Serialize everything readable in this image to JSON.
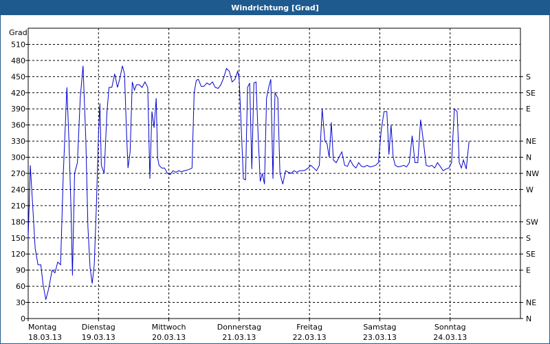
{
  "window": {
    "title": "Windrichtung [Grad]"
  },
  "chart_data": {
    "type": "line",
    "title": "Windrichtung [Grad]",
    "ylabel": "Grad",
    "ylim": [
      0,
      540
    ],
    "yticks": [
      0,
      30,
      60,
      90,
      120,
      150,
      180,
      210,
      240,
      270,
      300,
      330,
      360,
      390,
      420,
      450,
      480,
      510
    ],
    "right_labels": [
      {
        "value": 0,
        "label": "N"
      },
      {
        "value": 30,
        "label": "NE"
      },
      {
        "value": 90,
        "label": "E"
      },
      {
        "value": 120,
        "label": "SE"
      },
      {
        "value": 150,
        "label": "S"
      },
      {
        "value": 180,
        "label": "SW"
      },
      {
        "value": 240,
        "label": "W"
      },
      {
        "value": 270,
        "label": "NW"
      },
      {
        "value": 300,
        "label": "N"
      },
      {
        "value": 330,
        "label": "NE"
      },
      {
        "value": 390,
        "label": "E"
      },
      {
        "value": 420,
        "label": "SE"
      },
      {
        "value": 450,
        "label": "S"
      }
    ],
    "days": [
      {
        "day": "Montag",
        "date": "18.03.13"
      },
      {
        "day": "Dienstag",
        "date": "19.03.13"
      },
      {
        "day": "Mittwoch",
        "date": "20.03.13"
      },
      {
        "day": "Donnerstag",
        "date": "21.03.13"
      },
      {
        "day": "Freitag",
        "date": "22.03.13"
      },
      {
        "day": "Samstag",
        "date": "23.03.13"
      },
      {
        "day": "Sonntag",
        "date": "24.03.13"
      }
    ],
    "xlim_days": [
      0,
      7
    ],
    "grid": true,
    "line_color": "#0000cc",
    "series": [
      {
        "values": [
          [
            0.0,
            150
          ],
          [
            0.03,
            285
          ],
          [
            0.06,
            220
          ],
          [
            0.1,
            130
          ],
          [
            0.14,
            100
          ],
          [
            0.18,
            100
          ],
          [
            0.21,
            65
          ],
          [
            0.25,
            35
          ],
          [
            0.29,
            55
          ],
          [
            0.34,
            90
          ],
          [
            0.38,
            85
          ],
          [
            0.42,
            105
          ],
          [
            0.46,
            100
          ],
          [
            0.5,
            270
          ],
          [
            0.55,
            430
          ],
          [
            0.58,
            330
          ],
          [
            0.61,
            200
          ],
          [
            0.63,
            80
          ],
          [
            0.66,
            270
          ],
          [
            0.7,
            290
          ],
          [
            0.74,
            410
          ],
          [
            0.78,
            470
          ],
          [
            0.82,
            330
          ],
          [
            0.85,
            170
          ],
          [
            0.88,
            95
          ],
          [
            0.91,
            65
          ],
          [
            0.94,
            100
          ],
          [
            0.97,
            210
          ],
          [
            1.0,
            345
          ],
          [
            1.02,
            400
          ],
          [
            1.04,
            285
          ],
          [
            1.08,
            270
          ],
          [
            1.12,
            385
          ],
          [
            1.15,
            430
          ],
          [
            1.19,
            430
          ],
          [
            1.23,
            455
          ],
          [
            1.27,
            430
          ],
          [
            1.3,
            445
          ],
          [
            1.34,
            470
          ],
          [
            1.37,
            455
          ],
          [
            1.4,
            340
          ],
          [
            1.42,
            280
          ],
          [
            1.45,
            310
          ],
          [
            1.48,
            440
          ],
          [
            1.51,
            425
          ],
          [
            1.54,
            435
          ],
          [
            1.58,
            435
          ],
          [
            1.62,
            430
          ],
          [
            1.66,
            440
          ],
          [
            1.7,
            430
          ],
          [
            1.73,
            260
          ],
          [
            1.76,
            385
          ],
          [
            1.79,
            355
          ],
          [
            1.82,
            410
          ],
          [
            1.84,
            300
          ],
          [
            1.86,
            285
          ],
          [
            1.9,
            280
          ],
          [
            1.94,
            280
          ],
          [
            1.98,
            270
          ],
          [
            2.02,
            268
          ],
          [
            2.06,
            275
          ],
          [
            2.1,
            272
          ],
          [
            2.14,
            275
          ],
          [
            2.18,
            273
          ],
          [
            2.22,
            275
          ],
          [
            2.26,
            276
          ],
          [
            2.3,
            278
          ],
          [
            2.33,
            280
          ],
          [
            2.36,
            420
          ],
          [
            2.39,
            443
          ],
          [
            2.42,
            445
          ],
          [
            2.46,
            432
          ],
          [
            2.5,
            432
          ],
          [
            2.54,
            438
          ],
          [
            2.58,
            435
          ],
          [
            2.62,
            440
          ],
          [
            2.66,
            430
          ],
          [
            2.7,
            428
          ],
          [
            2.74,
            435
          ],
          [
            2.78,
            448
          ],
          [
            2.82,
            465
          ],
          [
            2.86,
            460
          ],
          [
            2.9,
            440
          ],
          [
            2.94,
            445
          ],
          [
            2.98,
            460
          ],
          [
            3.0,
            445
          ],
          [
            3.03,
            355
          ],
          [
            3.06,
            260
          ],
          [
            3.09,
            258
          ],
          [
            3.12,
            430
          ],
          [
            3.15,
            438
          ],
          [
            3.18,
            278
          ],
          [
            3.21,
            438
          ],
          [
            3.24,
            440
          ],
          [
            3.27,
            340
          ],
          [
            3.3,
            255
          ],
          [
            3.33,
            270
          ],
          [
            3.36,
            250
          ],
          [
            3.39,
            410
          ],
          [
            3.42,
            430
          ],
          [
            3.45,
            445
          ],
          [
            3.48,
            260
          ],
          [
            3.51,
            420
          ],
          [
            3.55,
            410
          ],
          [
            3.58,
            270
          ],
          [
            3.62,
            250
          ],
          [
            3.66,
            275
          ],
          [
            3.7,
            272
          ],
          [
            3.74,
            270
          ],
          [
            3.78,
            275
          ],
          [
            3.82,
            272
          ],
          [
            3.86,
            275
          ],
          [
            3.9,
            275
          ],
          [
            3.94,
            276
          ],
          [
            3.98,
            280
          ],
          [
            4.02,
            285
          ],
          [
            4.06,
            280
          ],
          [
            4.1,
            275
          ],
          [
            4.14,
            285
          ],
          [
            4.18,
            390
          ],
          [
            4.22,
            330
          ],
          [
            4.25,
            325
          ],
          [
            4.28,
            300
          ],
          [
            4.31,
            365
          ],
          [
            4.34,
            295
          ],
          [
            4.38,
            290
          ],
          [
            4.42,
            300
          ],
          [
            4.46,
            310
          ],
          [
            4.5,
            285
          ],
          [
            4.54,
            283
          ],
          [
            4.58,
            295
          ],
          [
            4.62,
            285
          ],
          [
            4.66,
            280
          ],
          [
            4.7,
            290
          ],
          [
            4.74,
            283
          ],
          [
            4.78,
            282
          ],
          [
            4.82,
            285
          ],
          [
            4.86,
            282
          ],
          [
            4.9,
            283
          ],
          [
            4.94,
            285
          ],
          [
            4.98,
            290
          ],
          [
            5.02,
            350
          ],
          [
            5.06,
            385
          ],
          [
            5.1,
            385
          ],
          [
            5.13,
            305
          ],
          [
            5.16,
            360
          ],
          [
            5.19,
            300
          ],
          [
            5.22,
            285
          ],
          [
            5.26,
            282
          ],
          [
            5.3,
            283
          ],
          [
            5.34,
            285
          ],
          [
            5.38,
            282
          ],
          [
            5.42,
            290
          ],
          [
            5.46,
            340
          ],
          [
            5.5,
            290
          ],
          [
            5.54,
            290
          ],
          [
            5.58,
            370
          ],
          [
            5.62,
            330
          ],
          [
            5.66,
            285
          ],
          [
            5.7,
            283
          ],
          [
            5.74,
            285
          ],
          [
            5.78,
            280
          ],
          [
            5.82,
            290
          ],
          [
            5.86,
            283
          ],
          [
            5.9,
            275
          ],
          [
            5.94,
            278
          ],
          [
            5.98,
            280
          ],
          [
            6.02,
            290
          ],
          [
            6.06,
            390
          ],
          [
            6.1,
            385
          ],
          [
            6.13,
            290
          ],
          [
            6.16,
            280
          ],
          [
            6.19,
            295
          ],
          [
            6.23,
            278
          ],
          [
            6.27,
            330
          ]
        ]
      }
    ]
  }
}
